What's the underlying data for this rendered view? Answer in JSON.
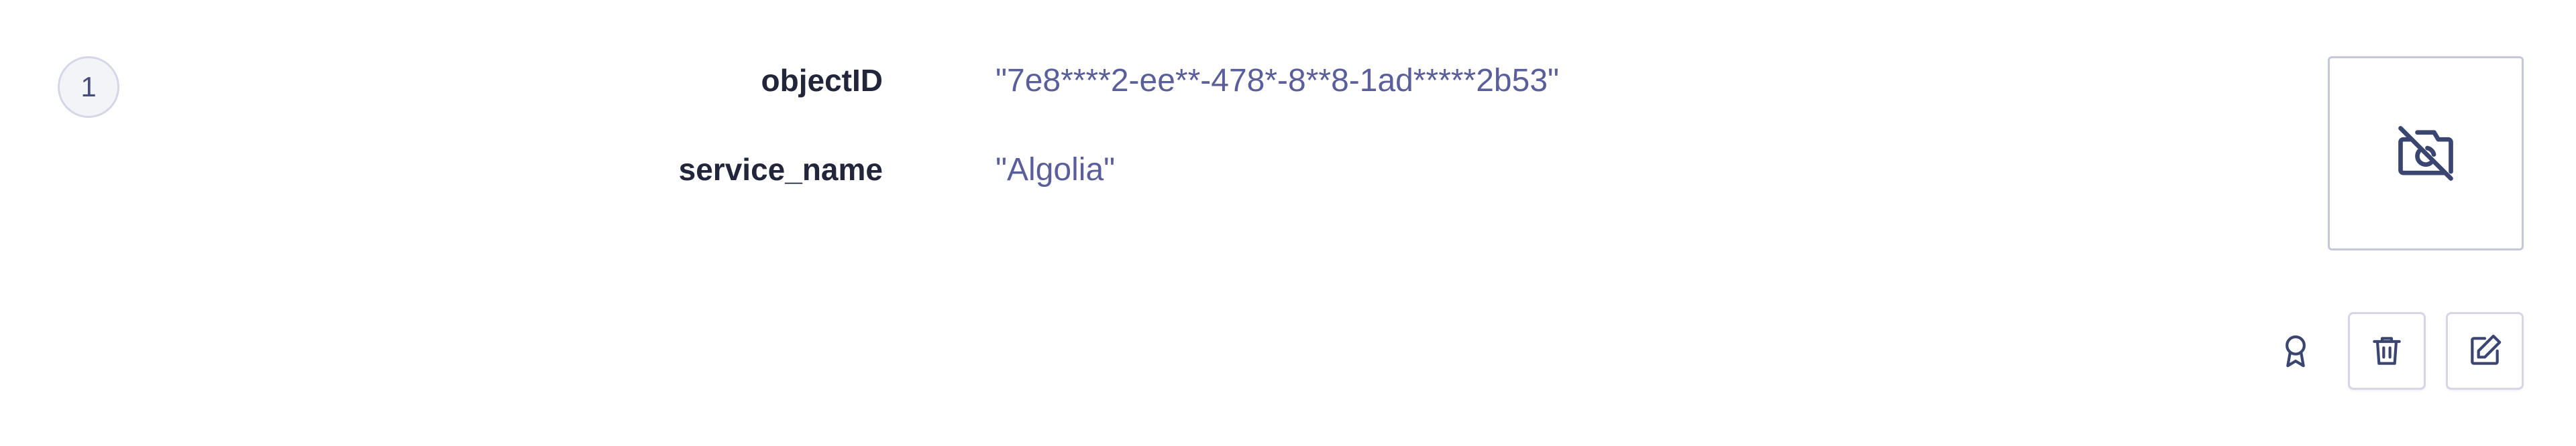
{
  "hit": {
    "index": "1",
    "attributes": [
      {
        "key": "objectID",
        "value": "\"7e8****2-ee**-478*-8**8-1ad*****2b53\""
      },
      {
        "key": "service_name",
        "value": "\"Algolia\""
      }
    ],
    "image": {
      "icon": "no-image-icon"
    },
    "actions": [
      {
        "icon": "ribbon-icon"
      },
      {
        "icon": "trash-icon"
      },
      {
        "icon": "edit-icon"
      }
    ]
  },
  "colors": {
    "value_text": "#5a5e9a",
    "key_text": "#23263b",
    "border": "#d6d6e7",
    "icon_stroke": "#3a4570"
  }
}
